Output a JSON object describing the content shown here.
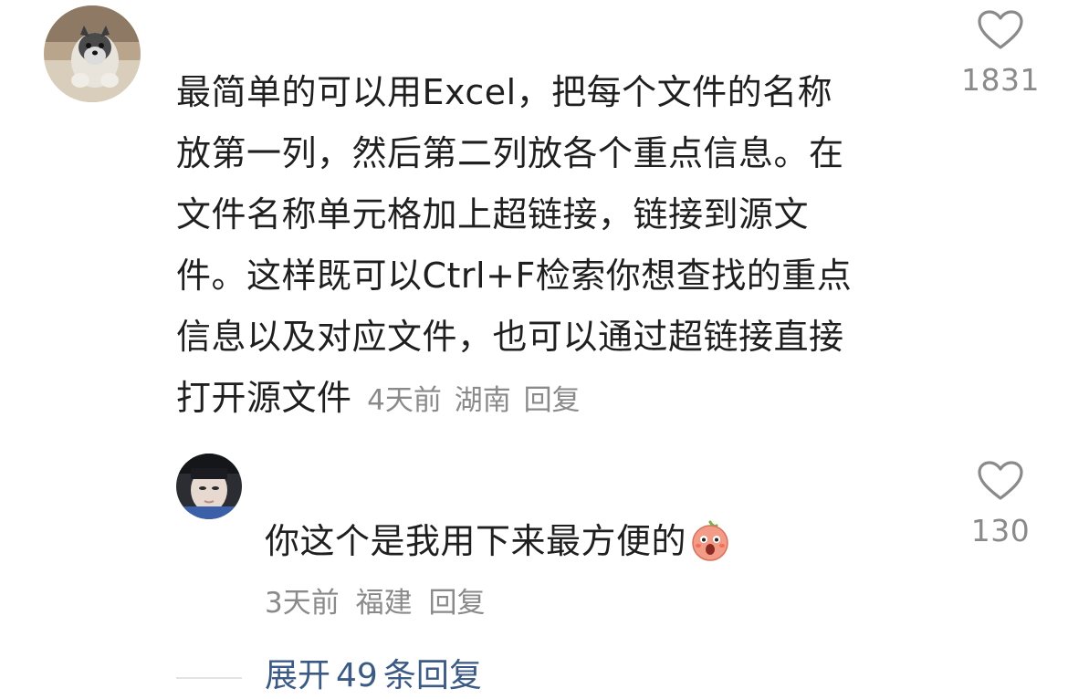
{
  "comment": {
    "avatar_icon": "dog-avatar-icon",
    "text": "最简单的可以用Excel，把每个文件的名称放第一列，然后第二列放各个重点信息。在文件名称单元格加上超链接，链接到源文件。这样既可以Ctrl+F检索你想查找的重点信息以及对应文件，也可以通过超链接直接打开源文件",
    "lines": [
      "最简单的可以用Excel，把每个文件的名称",
      "放第一列，然后第二列放各个重点信息。在",
      "文件名称单元格加上超链接，链接到源文",
      "件。这样既可以Ctrl+F检索你想查找的重点",
      "信息以及对应文件，也可以通过超链接直接",
      "打开源文件"
    ],
    "time": "4天前",
    "location": "湖南",
    "reply_label": "回复",
    "likes": "1831"
  },
  "reply": {
    "avatar_icon": "person-avatar-icon",
    "text": "你这个是我用下来最方便的",
    "emoji_icon": "surprised-emoji-icon",
    "time": "3天前",
    "location": "福建",
    "reply_label": "回复",
    "likes": "130"
  },
  "expand": {
    "label": "展开",
    "count": "49",
    "suffix": "条回复"
  },
  "colors": {
    "text": "#1f1f1f",
    "meta": "#8a8a8a",
    "link": "#3b5a85",
    "heart_stroke": "#8a8a8a"
  }
}
